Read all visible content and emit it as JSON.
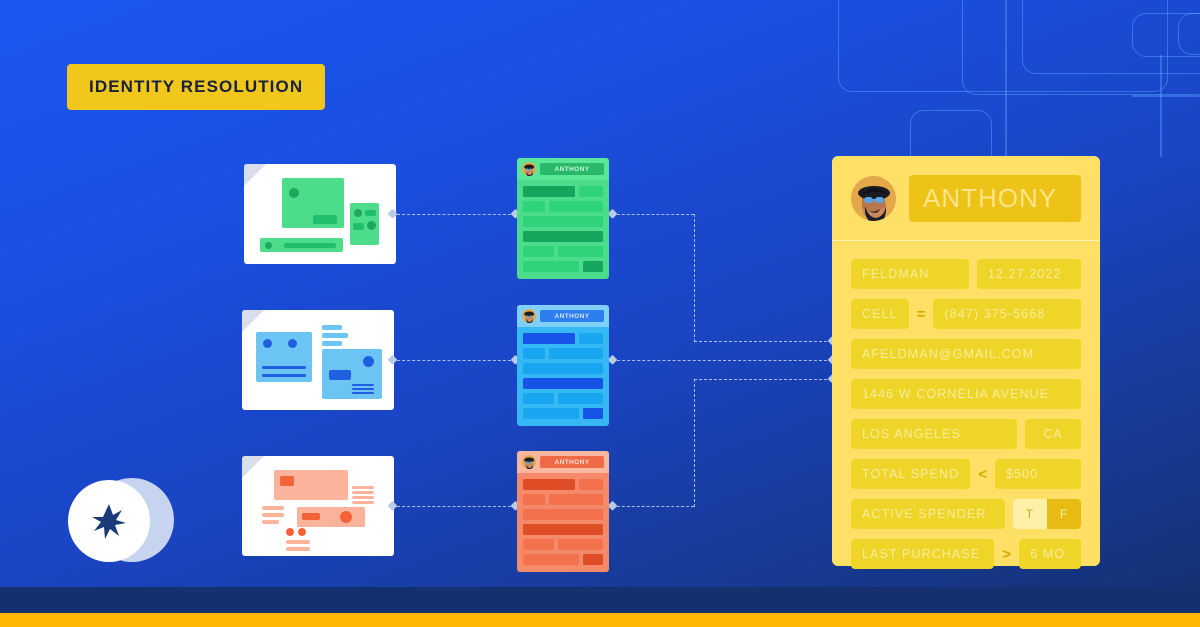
{
  "badge": {
    "label": "IDENTITY RESOLUTION"
  },
  "logo": {
    "icon": "star-burst-icon"
  },
  "sources": [
    {
      "name": "source-thumbnail-green",
      "accent": "#3ddc84",
      "accent_dark": "#16a55c"
    },
    {
      "name": "source-thumbnail-blue",
      "accent": "#6cc4f5",
      "accent_dark": "#1f5fe0"
    },
    {
      "name": "source-thumbnail-red",
      "accent": "#fbb49b",
      "accent_dark": "#f4623a"
    }
  ],
  "records": [
    {
      "name_label": "ANTHONY",
      "avatar": "avatar-icon",
      "bg": "#4bdd8c",
      "header_bg": "#5ce69a",
      "bar_light": "#2fd47a",
      "bar_dark": "#16a55c",
      "name_bg": "#29b86a",
      "name_color": "#c9f7dd"
    },
    {
      "name_label": "ANTHONY",
      "avatar": "avatar-icon",
      "bg": "#36b8f5",
      "header_bg": "#7fd0fb",
      "bar_light": "#18a6f0",
      "bar_dark": "#1654e8",
      "name_bg": "#2f7ef0",
      "name_color": "#cfe6ff"
    },
    {
      "name_label": "ANTHONY",
      "avatar": "avatar-icon",
      "bg": "#f58a6a",
      "header_bg": "#f9b7a0",
      "bar_light": "#f4714d",
      "bar_dark": "#e04e28",
      "name_bg": "#ee6a45",
      "name_color": "#ffe0d6"
    }
  ],
  "profile": {
    "avatar": "avatar-icon",
    "name": "ANTHONY",
    "fields": {
      "last_name": "FELDMAN",
      "date": "12.27.2022",
      "phone_label": "CELL",
      "phone_operator": "=",
      "phone_value": "(847) 375-5668",
      "email": "AFELDMAN@GMAIL.COM",
      "address": "1446 W CORNELIA AVENUE",
      "city": "LOS ANGELES",
      "state": "CA",
      "total_spend_label": "TOTAL SPEND",
      "total_spend_operator": "<",
      "total_spend_value": "$500",
      "active_spender_label": "ACTIVE SPENDER",
      "active_spender_true": "T",
      "active_spender_false": "F",
      "last_purchase_label": "LAST PURCHASE",
      "last_purchase_operator": ">",
      "last_purchase_value": "6 MO."
    }
  },
  "colors": {
    "background_top": "#1b57f2",
    "background_bottom": "#14306e",
    "badge_yellow": "#f2c71c",
    "card_yellow": "#ffe066",
    "bottom_bar": "#ffb703",
    "connector": "#c4d4f0"
  }
}
